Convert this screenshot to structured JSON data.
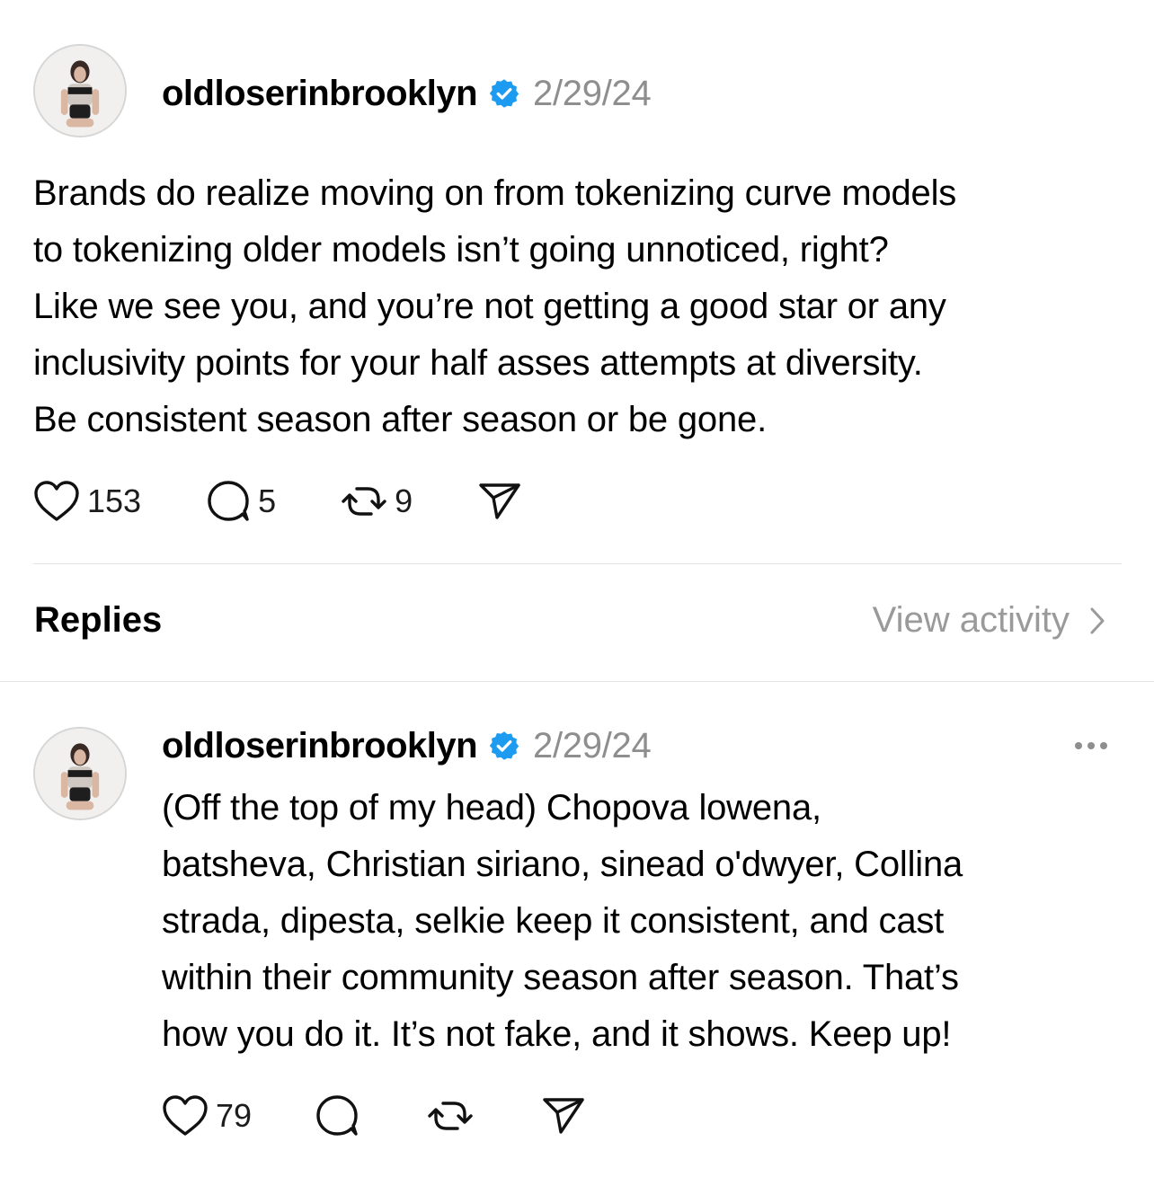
{
  "post": {
    "avatar_icon": "user-avatar-photo",
    "username": "oldloserinbrooklyn",
    "verified_icon": "verified-badge-icon",
    "date": "2/29/24",
    "text_lines": [
      "Brands do realize moving on from tokenizing curve models",
      "to tokenizing older models isn’t going unnoticed, right?",
      "Like we see you, and you’re not getting a good star or any",
      "inclusivity points for your half asses attempts at diversity.",
      "Be consistent season after season or be gone."
    ],
    "actions": {
      "like_count": "153",
      "comment_count": "5",
      "repost_count": "9"
    }
  },
  "replies_header": {
    "title": "Replies",
    "view_activity_label": "View activity"
  },
  "reply": {
    "avatar_icon": "user-avatar-photo",
    "username": "oldloserinbrooklyn",
    "verified_icon": "verified-badge-icon",
    "date": "2/29/24",
    "text_lines": [
      "(Off the top of my head) Chopova lowena,",
      "batsheva, Christian siriano, sinead o'dwyer, Collina",
      "strada, dipesta, selkie keep it consistent, and cast",
      "within their community season after season. That’s",
      "how you do it. It’s not fake, and it shows. Keep up!"
    ],
    "actions": {
      "like_count": "79"
    }
  },
  "colors": {
    "verified_blue": "#1d9bf0",
    "secondary_text": "#8e8e8e",
    "divider": "#e3e3e3"
  }
}
